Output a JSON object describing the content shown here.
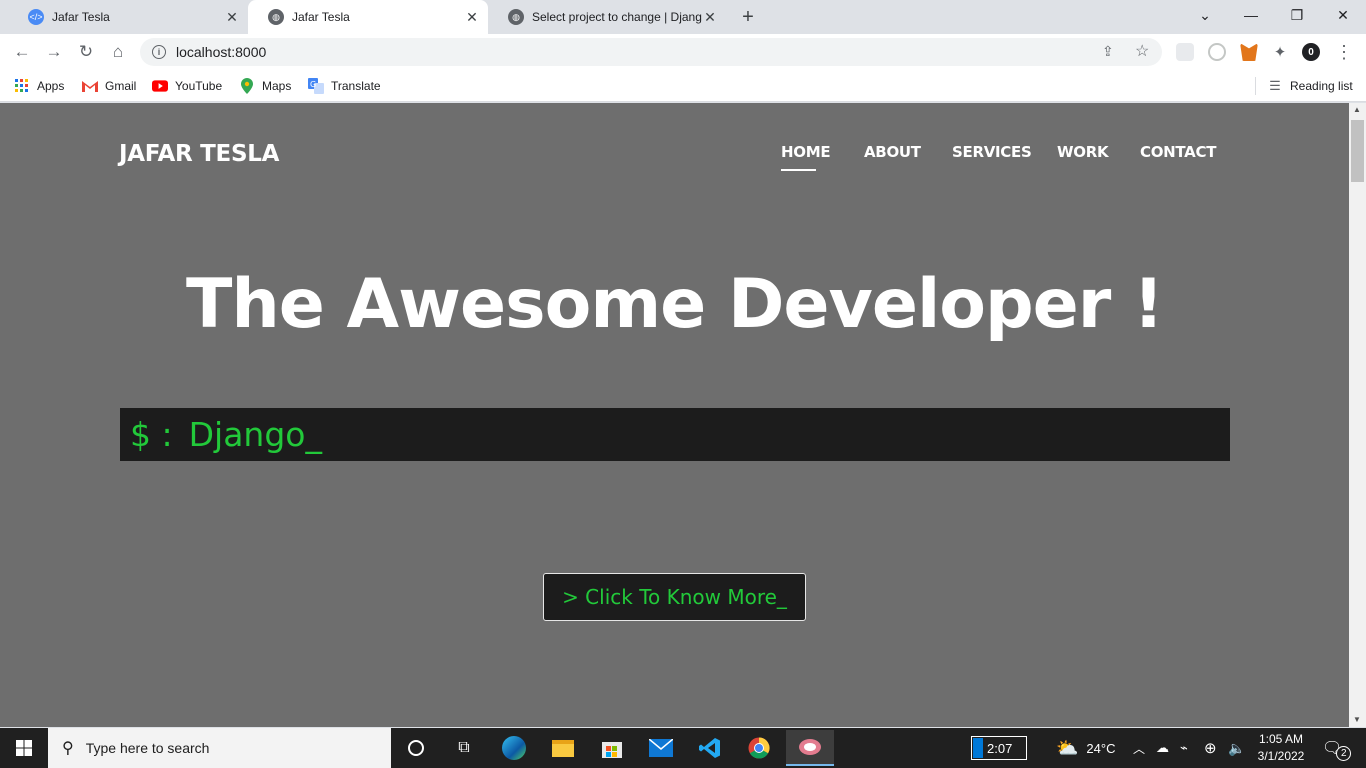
{
  "browser": {
    "tabs": [
      {
        "title": "Jafar Tesla",
        "icon": "code-favicon",
        "active": false
      },
      {
        "title": "Jafar Tesla",
        "icon": "globe-favicon",
        "active": true
      },
      {
        "title": "Select project to change | Django",
        "icon": "globe-favicon",
        "active": false
      }
    ],
    "url": "localhost:8000",
    "bookmarks": [
      {
        "label": "Apps",
        "icon": "apps-grid-icon"
      },
      {
        "label": "Gmail",
        "icon": "gmail-icon"
      },
      {
        "label": "YouTube",
        "icon": "youtube-icon"
      },
      {
        "label": "Maps",
        "icon": "maps-pin-icon"
      },
      {
        "label": "Translate",
        "icon": "translate-icon"
      }
    ],
    "reading_list": "Reading list"
  },
  "page": {
    "brand": "JAFAR TESLA",
    "nav": [
      "HOME",
      "ABOUT",
      "SERVICES",
      "WORK",
      "CONTACT"
    ],
    "active_nav": "HOME",
    "hero_title": "The Awesome Developer !",
    "terminal_prompt": "$ :",
    "terminal_text": "Django_",
    "cta_label": "> Click To Know More_",
    "colors": {
      "background": "#6e6e6e",
      "terminal": "#1c1c1c",
      "accent_green": "#22c93a"
    }
  },
  "taskbar": {
    "search_placeholder": "Type here to search",
    "battery": "2:07",
    "weather": "24°C",
    "time": "1:05 AM",
    "date": "3/1/2022",
    "notifications": "2"
  }
}
